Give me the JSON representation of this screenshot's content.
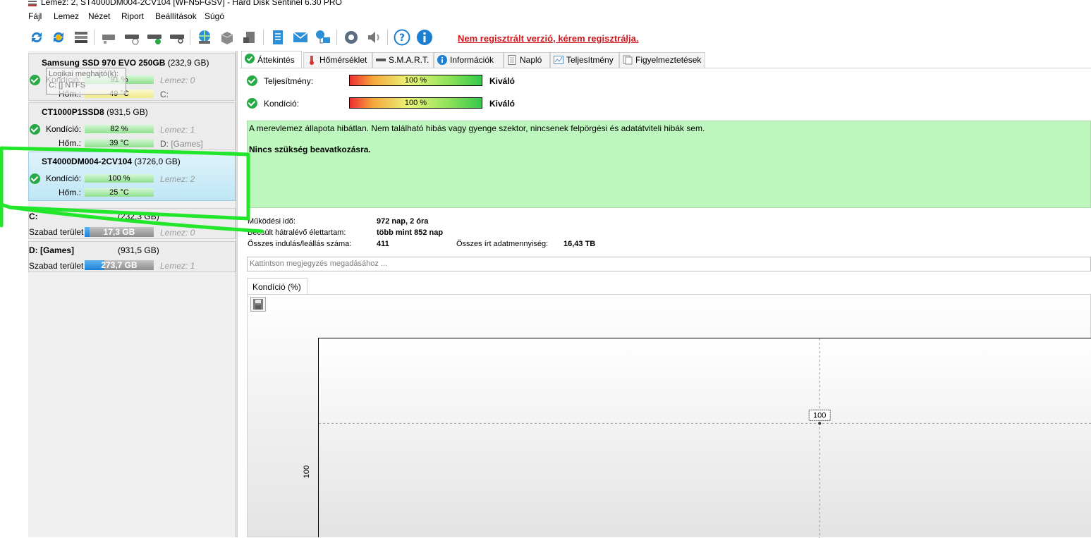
{
  "window": {
    "title": "Lemez: 2, ST4000DM004-2CV104 [WFN5FGSV]  -  Hard Disk Sentinel 6.30 PRO"
  },
  "menu": [
    "Fájl",
    "Lemez",
    "Nézet",
    "Riport",
    "Beállítások",
    "Súgó"
  ],
  "toolbar": {
    "icons": [
      "refresh-icon",
      "refresh-warning-icon",
      "disk-list-icon",
      "disk-icon",
      "disk-schedule-icon",
      "disk-check-icon",
      "disk-search-icon",
      "globe-disk-icon",
      "server-icon",
      "drive-icon",
      "report-icon",
      "email-icon",
      "network-icon",
      "settings-icon",
      "sound-icon",
      "help-icon",
      "info-icon"
    ],
    "unregistered": "Nem regisztrált verzió, kérem regisztrálja."
  },
  "disks": [
    {
      "name": "Samsung SSD 970 EVO 250GB",
      "size": "(232,9 GB)",
      "cond_label": "Kondíció:",
      "cond": "91 %",
      "cond_pct": 91,
      "temp_label": "Hőm.:",
      "temp": "49 °C",
      "disk_num": "Lemez: 0",
      "drive": "C:",
      "tooltip_1": "Logikai meghajtó(k):",
      "tooltip_2": "C: [] NTFS"
    },
    {
      "name": "CT1000P1SSD8",
      "size": "(931,5 GB)",
      "cond_label": "Kondíció:",
      "cond": "82 %",
      "cond_pct": 82,
      "temp_label": "Hőm.:",
      "temp": "39 °C",
      "disk_num": "Lemez: 1",
      "drive": "D:",
      "drive_name": "[Games]"
    },
    {
      "name": "ST4000DM004-2CV104",
      "size": "(3726,0 GB)",
      "cond_label": "Kondíció:",
      "cond": "100 %",
      "cond_pct": 100,
      "temp_label": "Hőm.:",
      "temp": "25 °C",
      "disk_num": "Lemez: 2"
    }
  ],
  "partitions": [
    {
      "name": "C:",
      "size": "(232,3 GB)",
      "free_label": "Szabad terület",
      "free": "17,3 GB",
      "free_pct": 7,
      "disk_num": "Lemez: 0"
    },
    {
      "name": "D: [Games]",
      "size": "(931,5 GB)",
      "free_label": "Szabad terület",
      "free": "273,7 GB",
      "free_pct": 29,
      "disk_num": "Lemez: 1"
    }
  ],
  "tabs": [
    {
      "label": "Áttekintés",
      "icon": "check-circle-icon"
    },
    {
      "label": "Hőmérséklet",
      "icon": "thermometer-icon"
    },
    {
      "label": "S.M.A.R.T.",
      "icon": "disk-icon"
    },
    {
      "label": "Információk",
      "icon": "info-icon"
    },
    {
      "label": "Napló",
      "icon": "document-icon"
    },
    {
      "label": "Teljesítmény",
      "icon": "performance-chart-icon"
    },
    {
      "label": "Figyelmeztetések",
      "icon": "warnings-icon"
    }
  ],
  "overview": {
    "performance_label": "Teljesítmény:",
    "performance": "100 %",
    "performance_rating": "Kiváló",
    "condition_label": "Kondíció:",
    "condition": "100 %",
    "condition_rating": "Kiváló",
    "message": "A merevlemez állapota hibátlan. Nem található hibás vagy gyenge szektor, nincsenek felpörgési és adatátviteli hibák sem.",
    "action": "Nincs szükség beavatkozásra.",
    "uptime_label": "Működési idő:",
    "uptime": "972 nap, 2 óra",
    "lifetime_label": "Becsült hátralévő élettartam:",
    "lifetime": "több mint 852 nap",
    "startstop_label": "Összes indulás/leállás száma:",
    "startstop": "411",
    "written_label": "Összes írt adatmennyiség:",
    "written": "16,43 TB",
    "note_placeholder": "Kattintson megjegyzés megadásához ..."
  },
  "chart_tab": "Kondíció  (%)",
  "chart_data": {
    "type": "line",
    "ylabel": "",
    "xlabel": "",
    "y_ticks": [
      100
    ],
    "points": [
      {
        "y": 100,
        "label": "100"
      }
    ]
  },
  "colors": {
    "unregistered": "#d0161c",
    "ok_green": "#27a945",
    "info_bg": "#bdf7bd",
    "highlight": "#22e62a"
  }
}
